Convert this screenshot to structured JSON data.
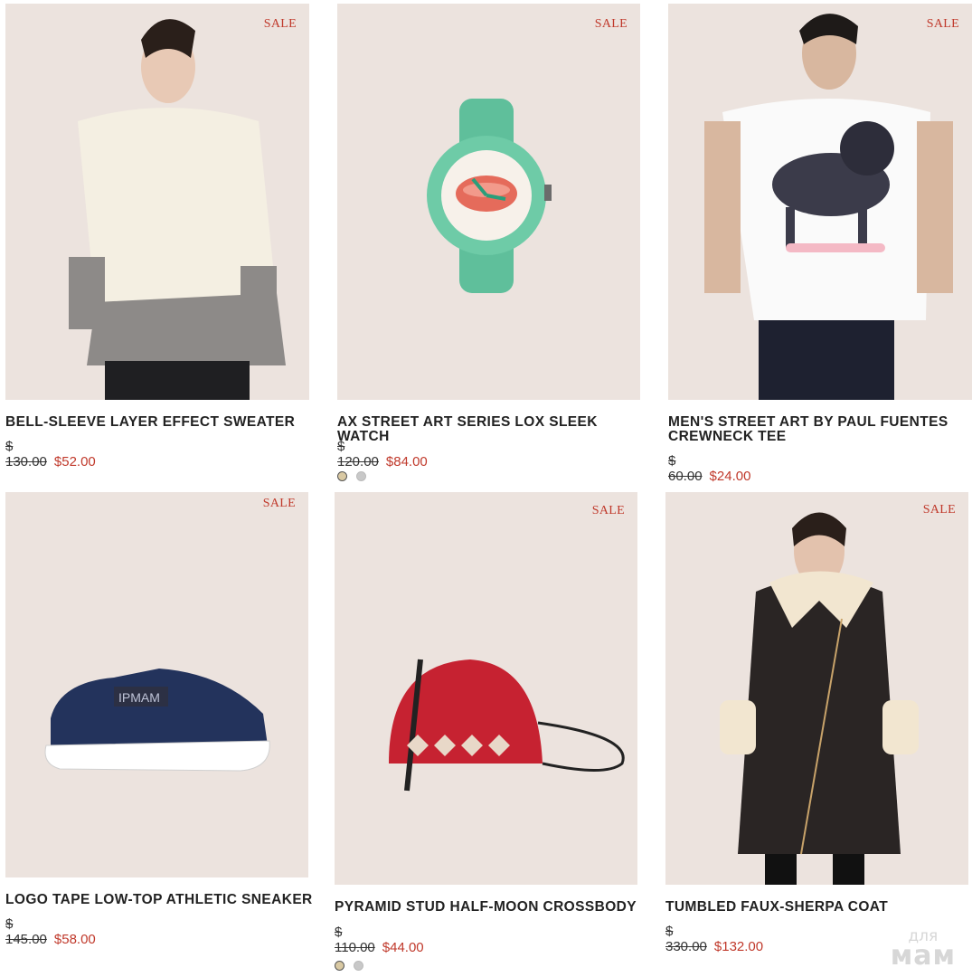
{
  "products": [
    {
      "name": "BELL-SLEEVE LAYER EFFECT SWEATER",
      "old_price": "$ 130.00",
      "new_price": "$52.00",
      "badge": "SALE",
      "image": "woman-sweater-photo"
    },
    {
      "name": "AX STREET ART SERIES LOX SLEEK WATCH",
      "old_price": "$ 120.00",
      "new_price": "$84.00",
      "badge": "SALE",
      "image": "green-watch-photo"
    },
    {
      "name": "MEN'S STREET ART BY PAUL FUENTES CREWNECK TEE",
      "old_price": "$ 60.00",
      "new_price": "$24.00",
      "badge": "SALE",
      "image": "man-lion-tee-photo"
    },
    {
      "name": "LOGO TAPE LOW-TOP ATHLETIC SNEAKER",
      "old_price": "$ 145.00",
      "new_price": "$58.00",
      "badge": "SALE",
      "image": "navy-sneaker-photo"
    },
    {
      "name": "PYRAMID STUD HALF-MOON CROSSBODY",
      "old_price": "$ 110.00",
      "new_price": "$44.00",
      "badge": "SALE",
      "image": "red-crossbody-photo"
    },
    {
      "name": "TUMBLED FAUX-SHERPA COAT",
      "old_price": "$ 330.00",
      "new_price": "$132.00",
      "badge": "SALE",
      "image": "woman-coat-photo"
    }
  ],
  "colors": {
    "sale": "#c0392b",
    "card_bg": "#ede4df"
  },
  "watermark": {
    "line1": "для",
    "line2": "мам"
  }
}
